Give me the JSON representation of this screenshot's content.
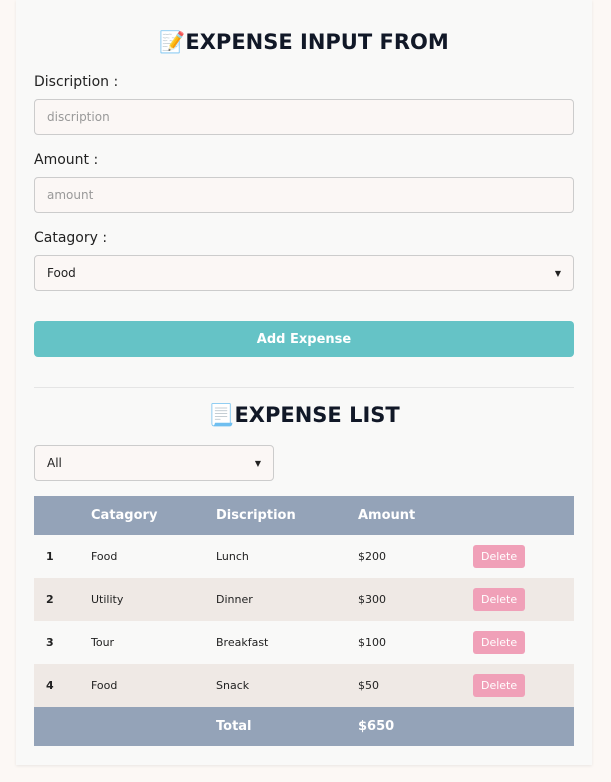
{
  "form": {
    "title_icon": "📝",
    "title": "EXPENSE INPUT FROM",
    "description_label": "Discription :",
    "description_placeholder": "discription",
    "amount_label": "Amount :",
    "amount_placeholder": "amount",
    "category_label": "Catagory :",
    "category_value": "Food",
    "add_button": "Add Expense"
  },
  "list": {
    "title_icon": "📃",
    "title": "EXPENSE LIST",
    "filter_value": "All",
    "headers": [
      "",
      "Catagory",
      "Discription",
      "Amount",
      ""
    ],
    "rows": [
      {
        "no": "1",
        "category": "Food",
        "description": "Lunch",
        "amount": "$200",
        "action": "Delete"
      },
      {
        "no": "2",
        "category": "Utility",
        "description": "Dinner",
        "amount": "$300",
        "action": "Delete"
      },
      {
        "no": "3",
        "category": "Tour",
        "description": "Breakfast",
        "amount": "$100",
        "action": "Delete"
      },
      {
        "no": "4",
        "category": "Food",
        "description": "Snack",
        "amount": "$50",
        "action": "Delete"
      }
    ],
    "total_label": "Total",
    "total_value": "$650"
  }
}
